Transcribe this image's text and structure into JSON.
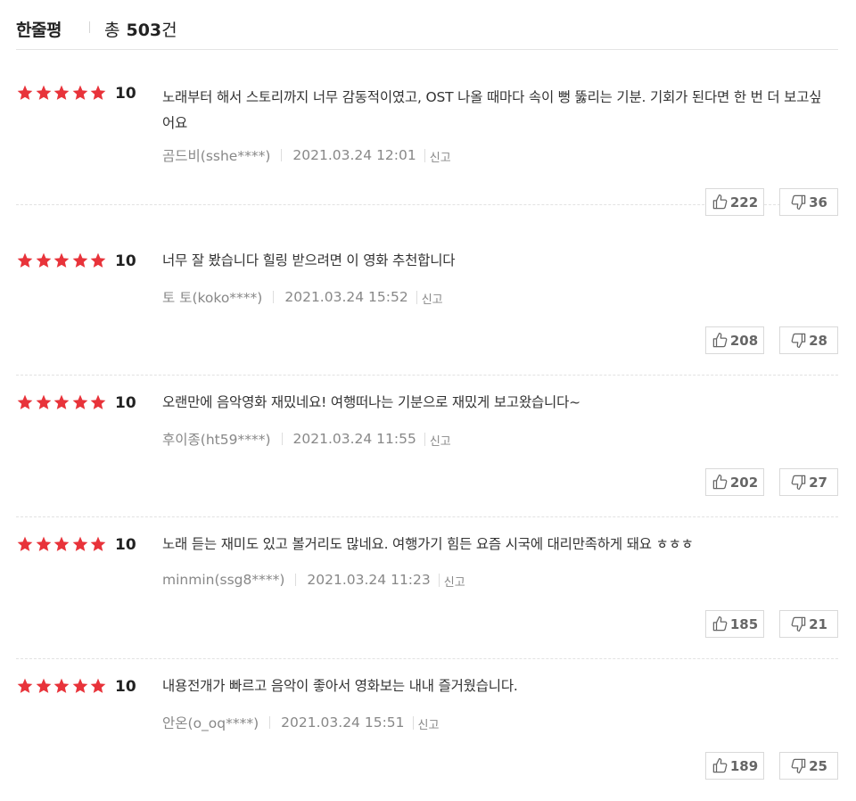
{
  "header": {
    "title": "한줄평",
    "total_label": "총",
    "total_count": "503",
    "total_suffix": "건"
  },
  "colors": {
    "star": "#e8333a",
    "text": "#333333",
    "meta": "#888888"
  },
  "reviews": [
    {
      "rating": 5,
      "score": "10",
      "text": "노래부터 해서 스토리까지 너무 감동적이였고, OST 나올 때마다 속이 뻥 뚫리는 기분. 기회가 된다면 한 번 더 보고싶어요",
      "author": "곰드비(sshe****)",
      "date": "2021.03.24 12:01",
      "report": "신고",
      "likes": "222",
      "dislikes": "36"
    },
    {
      "rating": 5,
      "score": "10",
      "text": "너무 잘 봤습니다 힐링 받으려면 이 영화 추천합니다",
      "author": "토 토(koko****)",
      "date": "2021.03.24 15:52",
      "report": "신고",
      "likes": "208",
      "dislikes": "28"
    },
    {
      "rating": 5,
      "score": "10",
      "text": "오랜만에 음악영화 재밌네요! 여행떠나는 기분으로 재밌게 보고왔습니다~",
      "author": "후이종(ht59****)",
      "date": "2021.03.24 11:55",
      "report": "신고",
      "likes": "202",
      "dislikes": "27"
    },
    {
      "rating": 5,
      "score": "10",
      "text": "노래 듣는 재미도 있고 볼거리도 많네요. 여행가기 힘든 요즘 시국에 대리만족하게 돼요 ㅎㅎㅎ",
      "author": "minmin(ssg8****)",
      "date": "2021.03.24 11:23",
      "report": "신고",
      "likes": "185",
      "dislikes": "21"
    },
    {
      "rating": 5,
      "score": "10",
      "text": "내용전개가 빠르고 음악이 좋아서 영화보는 내내 즐거웠습니다.",
      "author": "안온(o_oq****)",
      "date": "2021.03.24 15:51",
      "report": "신고",
      "likes": "189",
      "dislikes": "25"
    }
  ]
}
